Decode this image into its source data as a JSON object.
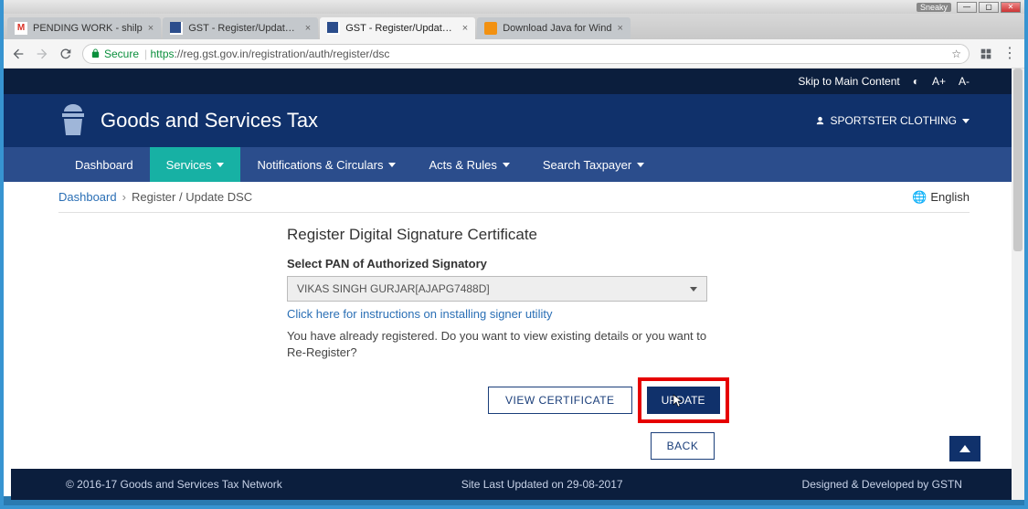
{
  "window": {
    "sneaky": "Sneaky"
  },
  "tabs": [
    {
      "label": "PENDING WORK - shilp",
      "active": false,
      "icon": "gmail"
    },
    {
      "label": "GST - Register/Update D",
      "active": false,
      "icon": "gst"
    },
    {
      "label": "GST - Register/Update D",
      "active": true,
      "icon": "gst"
    },
    {
      "label": "Download Java for Wind",
      "active": false,
      "icon": "java"
    }
  ],
  "addressbar": {
    "secure": "Secure",
    "https": "https",
    "rest": "://reg.gst.gov.in/registration/auth/register/dsc"
  },
  "topstrip": {
    "skip": "Skip to Main Content",
    "a_plus": "A+",
    "a_minus": "A-"
  },
  "header": {
    "title": "Goods and Services Tax",
    "user": "SPORTSTER CLOTHING"
  },
  "nav": {
    "dashboard": "Dashboard",
    "services": "Services",
    "notifications": "Notifications & Circulars",
    "acts": "Acts & Rules",
    "search": "Search Taxpayer"
  },
  "breadcrumb": {
    "dash": "Dashboard",
    "current": "Register / Update DSC",
    "lang": "English"
  },
  "form": {
    "title": "Register Digital Signature Certificate",
    "label": "Select PAN of Authorized Signatory",
    "selected": "VIKAS SINGH GURJAR[AJAPG7488D]",
    "instruction_link": "Click here for instructions on installing signer utility",
    "message": "You have already registered. Do you want to view existing details or you want to Re-Register?",
    "view_btn": "VIEW CERTIFICATE",
    "update_btn": "UPDATE",
    "back_btn": "BACK"
  },
  "footer": {
    "copyright": "© 2016-17 Goods and Services Tax Network",
    "updated": "Site Last Updated on 29-08-2017",
    "credit": "Designed & Developed by GSTN"
  }
}
